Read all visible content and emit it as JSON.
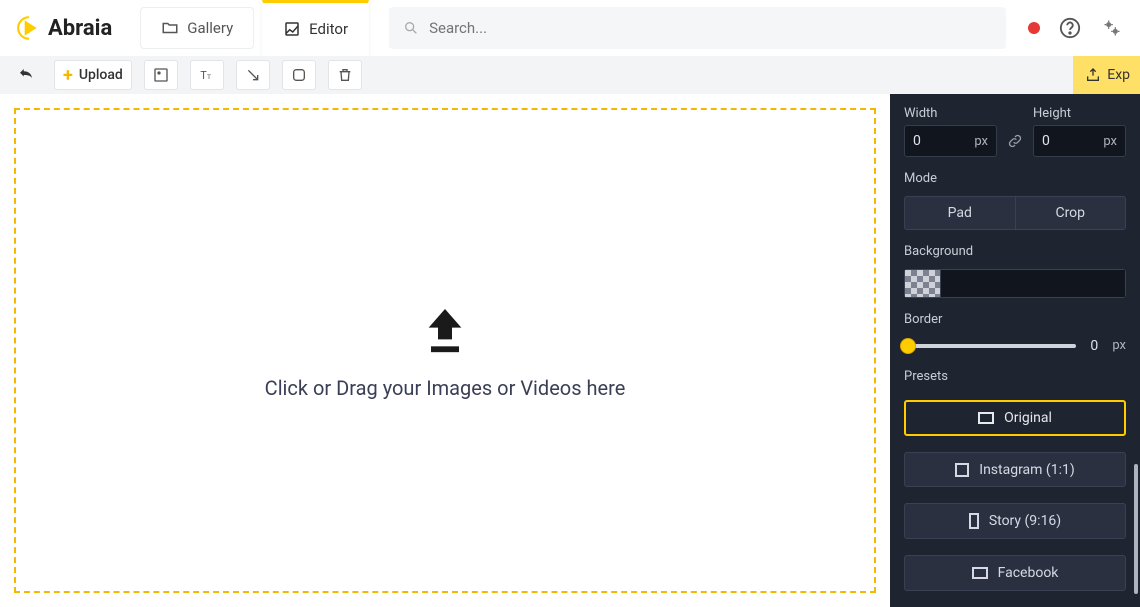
{
  "app": {
    "name": "Abraia"
  },
  "nav": {
    "gallery": "Gallery",
    "editor": "Editor",
    "active": "editor"
  },
  "search": {
    "placeholder": "Search..."
  },
  "toolbar": {
    "upload": "Upload",
    "export": "Exp"
  },
  "dropzone": {
    "text": "Click or Drag your Images or Videos here"
  },
  "panel": {
    "width_label": "Width",
    "height_label": "Height",
    "width_value": "0",
    "height_value": "0",
    "unit": "px",
    "mode_label": "Mode",
    "mode_pad": "Pad",
    "mode_crop": "Crop",
    "background_label": "Background",
    "border_label": "Border",
    "border_value": "0",
    "presets_label": "Presets",
    "presets": {
      "original": "Original",
      "instagram": "Instagram (1:1)",
      "story": "Story (9:16)",
      "facebook": "Facebook"
    }
  }
}
